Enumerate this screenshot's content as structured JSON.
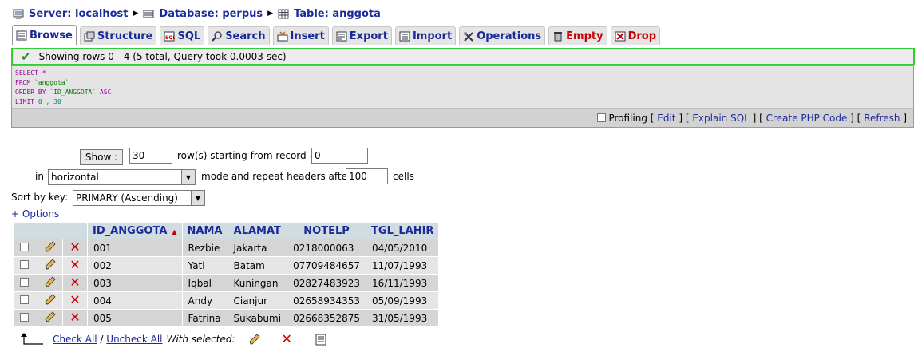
{
  "breadcrumb": {
    "server": "Server: localhost",
    "database": "Database: perpus",
    "table": "Table: anggota"
  },
  "tabs": [
    {
      "label": "Browse",
      "icon": "browse-icon",
      "active": true
    },
    {
      "label": "Structure",
      "icon": "structure-icon"
    },
    {
      "label": "SQL",
      "icon": "sql-icon"
    },
    {
      "label": "Search",
      "icon": "search-icon"
    },
    {
      "label": "Insert",
      "icon": "insert-icon"
    },
    {
      "label": "Export",
      "icon": "export-icon"
    },
    {
      "label": "Import",
      "icon": "import-icon"
    },
    {
      "label": "Operations",
      "icon": "operations-icon"
    },
    {
      "label": "Empty",
      "icon": "empty-icon",
      "danger": true
    },
    {
      "label": "Drop",
      "icon": "drop-icon",
      "danger": true
    }
  ],
  "notice": {
    "text": "Showing rows 0 - 4 (5 total, Query took 0.0003 sec)"
  },
  "sql": {
    "line1_kw": "SELECT",
    "line1_rest": " *",
    "line2_kw": "FROM",
    "line2_str": " `anggota`",
    "line3_kw": "ORDER BY",
    "line3_str": " `ID_ANGGOTA`",
    "line3_kw2": " ASC",
    "line4_kw": "LIMIT",
    "line4_num": " 0 , 30",
    "profiling": "Profiling",
    "edit": "Edit",
    "explain": "Explain SQL",
    "php": "Create PHP Code",
    "refresh": "Refresh"
  },
  "nav": {
    "show_label": "Show :",
    "rows_value": "30",
    "starting_text": "row(s) starting from record #",
    "start_value": "0",
    "in_label": "in",
    "mode_value": "horizontal",
    "mode_text": "mode and repeat headers after",
    "repeat_value": "100",
    "cells_text": "cells",
    "sortkey_label": "Sort by key:",
    "sortkey_value": "PRIMARY (Ascending)",
    "options_label": "+ Options"
  },
  "table": {
    "columns": [
      "ID_ANGGOTA",
      "NAMA",
      "ALAMAT",
      "NOTELP",
      "TGL_LAHIR"
    ],
    "rows": [
      [
        "001",
        "Rezbie",
        "Jakarta",
        "0218000063",
        "04/05/2010"
      ],
      [
        "002",
        "Yati",
        "Batam",
        "07709484657",
        "11/07/1993"
      ],
      [
        "003",
        "Iqbal",
        "Kuningan",
        "02827483923",
        "16/11/1993"
      ],
      [
        "004",
        "Andy",
        "Cianjur",
        "02658934353",
        "05/09/1993"
      ],
      [
        "005",
        "Fatrina",
        "Sukabumi",
        "02668352875",
        "31/05/1993"
      ]
    ]
  },
  "bottom": {
    "check_all": "Check All",
    "slash": " / ",
    "uncheck_all": "Uncheck All",
    "with_selected": "With selected:"
  }
}
